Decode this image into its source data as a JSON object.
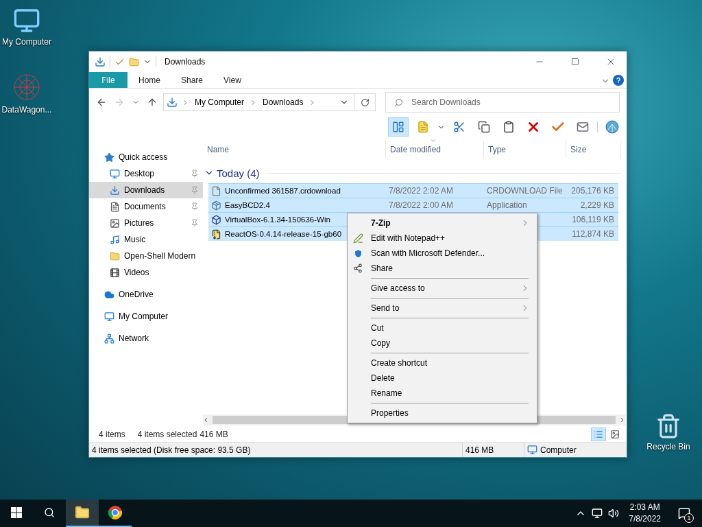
{
  "desktop_icons": [
    {
      "label": "My Computer"
    },
    {
      "label": "DataWagon..."
    }
  ],
  "recycle_bin": {
    "label": "Recycle Bin"
  },
  "window": {
    "title": "Downloads",
    "ribbon_tabs": [
      {
        "label": "File",
        "kind": "menu"
      },
      {
        "label": "Home",
        "kind": "tab"
      },
      {
        "label": "Share",
        "kind": "tab"
      },
      {
        "label": "View",
        "kind": "tab"
      }
    ],
    "address": {
      "path": [
        "My Computer",
        "Downloads"
      ]
    },
    "search": {
      "placeholder": "Search Downloads"
    },
    "sidebar": {
      "items": [
        {
          "label": "Quick access",
          "selected": false,
          "children": [
            {
              "label": "Desktop",
              "pinned": true,
              "selected": false
            },
            {
              "label": "Downloads",
              "pinned": true,
              "selected": true
            },
            {
              "label": "Documents",
              "pinned": true,
              "selected": false
            },
            {
              "label": "Pictures",
              "pinned": true,
              "selected": false
            },
            {
              "label": "Music",
              "pinned": false,
              "selected": false
            },
            {
              "label": "Open-Shell Modern",
              "pinned": false,
              "selected": false
            },
            {
              "label": "Videos",
              "pinned": false,
              "selected": false
            }
          ]
        },
        {
          "label": "OneDrive",
          "selected": false
        },
        {
          "label": "My Computer",
          "selected": false
        },
        {
          "label": "Network",
          "selected": false
        }
      ]
    },
    "columns": [
      {
        "label": "Name",
        "sorted": false
      },
      {
        "label": "Date modified",
        "sorted": true
      },
      {
        "label": "Type",
        "sorted": false
      },
      {
        "label": "Size",
        "sorted": false
      }
    ],
    "group": {
      "label": "Today (4)",
      "expanded": true
    },
    "rows": [
      {
        "kind": "document",
        "name": "Unconfirmed 361587.crdownload",
        "date": "7/8/2022 2:02 AM",
        "type": "CRDOWNLOAD File",
        "size": "205,176 KB",
        "selected": true
      },
      {
        "kind": "installer",
        "name": "EasyBCD2.4",
        "date": "7/8/2022 2:00 AM",
        "type": "Application",
        "size": "2,229 KB",
        "selected": true
      },
      {
        "kind": "cube",
        "name": "VirtualBox-6.1.34-150636-Win",
        "size": "106,119 KB",
        "selected": true
      },
      {
        "kind": "archive",
        "name": "ReactOS-0.4.14-release-15-gb60",
        "size": "112,874 KB",
        "selected": true
      }
    ],
    "details": {
      "count": "4 items",
      "selection": "4 items selected",
      "size": "416 MB"
    },
    "status_bar": {
      "text": "4 items selected (Disk free space: 93.5 GB)",
      "size": "416 MB",
      "location": "Computer"
    }
  },
  "context_menu": {
    "sections": [
      [
        {
          "label": "7-Zip",
          "bold": true,
          "submenu": true
        },
        {
          "label": "Edit with Notepad++",
          "bold": false,
          "submenu": false
        },
        {
          "label": "Scan with Microsoft Defender...",
          "bold": false,
          "submenu": false
        },
        {
          "label": "Share",
          "bold": false,
          "submenu": false
        }
      ],
      [
        {
          "label": "Give access to",
          "bold": false,
          "submenu": true
        }
      ],
      [
        {
          "label": "Send to",
          "bold": false,
          "submenu": true
        }
      ],
      [
        {
          "label": "Cut",
          "bold": false,
          "submenu": false
        },
        {
          "label": "Copy",
          "bold": false,
          "submenu": false
        }
      ],
      [
        {
          "label": "Create shortcut",
          "bold": false,
          "submenu": false
        },
        {
          "label": "Delete",
          "bold": false,
          "submenu": false
        },
        {
          "label": "Rename",
          "bold": false,
          "submenu": false
        }
      ],
      [
        {
          "label": "Properties",
          "bold": false,
          "submenu": false
        }
      ]
    ]
  },
  "taskbar": {
    "apps": [
      {
        "kind": "explorer",
        "selected": true
      },
      {
        "kind": "browser",
        "selected": false
      }
    ],
    "time": "2:03 AM",
    "date": "7/8/2022",
    "notifications": "1"
  }
}
